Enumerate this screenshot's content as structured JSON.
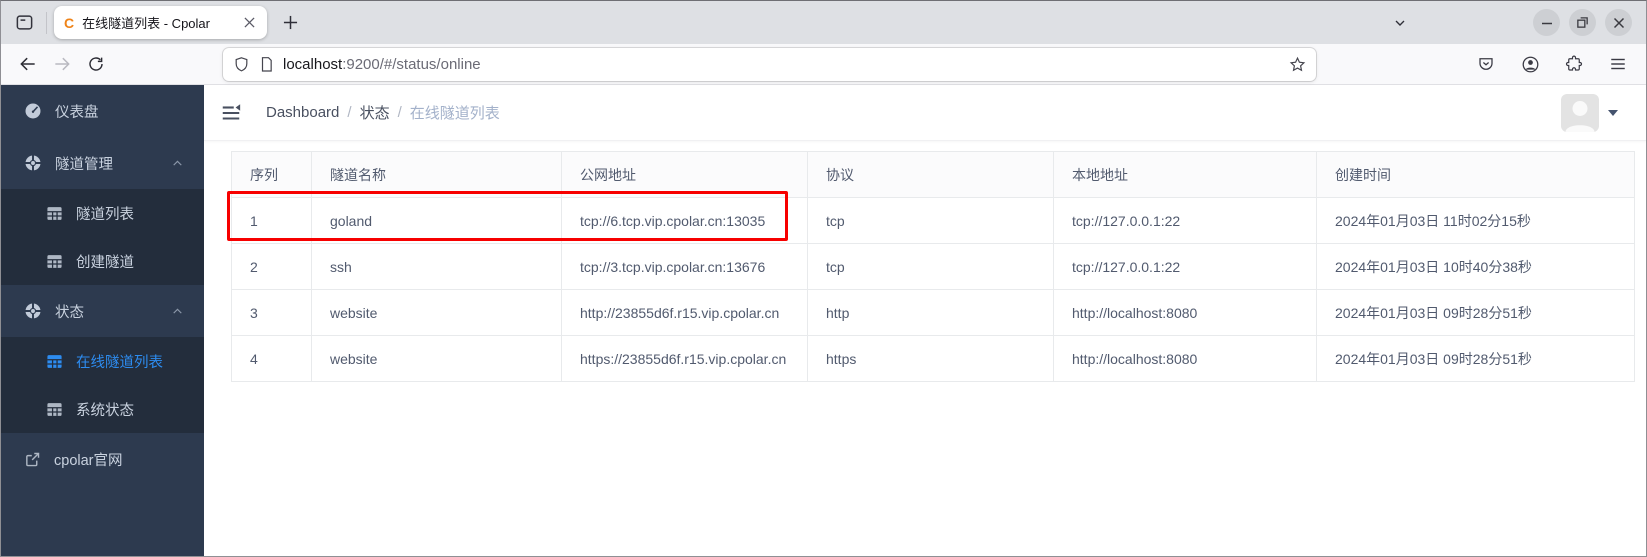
{
  "browser": {
    "tab": {
      "favicon_letter": "C",
      "title": "在线隧道列表 - Cpolar"
    },
    "url": {
      "host": "localhost",
      "rest": ":9200/#/status/online"
    }
  },
  "sidebar": {
    "dashboard": "仪表盘",
    "tunnel_mgmt": "隧道管理",
    "tunnel_list": "隧道列表",
    "create_tunnel": "创建隧道",
    "status": "状态",
    "online_tunnel_list": "在线隧道列表",
    "system_status": "系统状态",
    "cpolar_site": "cpolar官网"
  },
  "breadcrumb": {
    "separator": "/",
    "items": [
      "Dashboard",
      "状态",
      "在线隧道列表"
    ]
  },
  "table": {
    "headers": [
      "序列",
      "隧道名称",
      "公网地址",
      "协议",
      "本地地址",
      "创建时间"
    ],
    "rows": [
      [
        "1",
        "goland",
        "tcp://6.tcp.vip.cpolar.cn:13035",
        "tcp",
        "tcp://127.0.0.1:22",
        "2024年01月03日 11时02分15秒"
      ],
      [
        "2",
        "ssh",
        "tcp://3.tcp.vip.cpolar.cn:13676",
        "tcp",
        "tcp://127.0.0.1:22",
        "2024年01月03日 10时40分38秒"
      ],
      [
        "3",
        "website",
        "http://23855d6f.r15.vip.cpolar.cn",
        "http",
        "http://localhost:8080",
        "2024年01月03日 09时28分51秒"
      ],
      [
        "4",
        "website",
        "https://23855d6f.r15.vip.cpolar.cn",
        "https",
        "http://localhost:8080",
        "2024年01月03日 09时28分51秒"
      ]
    ],
    "highlight_row_index": 1,
    "highlight_color": "#f70000"
  },
  "colors": {
    "accent_blue": "#2d8cf0",
    "sidebar_bg": "#2d3a4f",
    "sidebar_submenu_bg": "#232d3c",
    "table_border": "#e8eaec",
    "text": "#515a6e"
  }
}
